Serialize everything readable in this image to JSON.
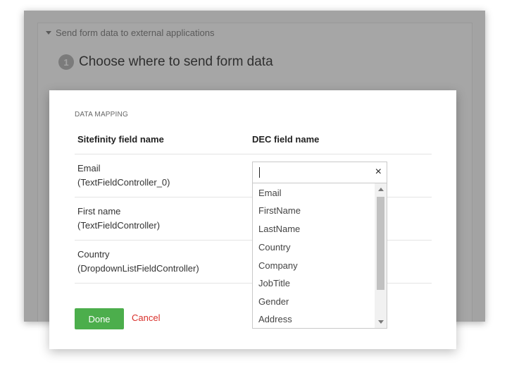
{
  "background": {
    "section_toggle": "Send form data to external applications",
    "step_number": "1",
    "step_title": "Choose where to send form data"
  },
  "modal": {
    "section_label": "DATA MAPPING",
    "columns": {
      "sitefinity": "Sitefinity field name",
      "dec": "DEC  field name"
    },
    "rows": [
      {
        "name": "Email",
        "controller": "(TextFieldController_0)"
      },
      {
        "name": "First name",
        "controller": "(TextFieldController)"
      },
      {
        "name": "Country",
        "controller": "(DropdownListFieldController)"
      }
    ],
    "combo": {
      "value": "",
      "clear_icon": "×",
      "options": [
        "Email",
        "FirstName",
        "LastName",
        "Country",
        "Company",
        "JobTitle",
        "Gender",
        "Address"
      ]
    },
    "done_label": "Done",
    "cancel_label": "Cancel"
  },
  "colors": {
    "accent_green": "#4cae4c",
    "cancel_red": "#d9302b",
    "overlay_gray": "#a3a3a3"
  }
}
